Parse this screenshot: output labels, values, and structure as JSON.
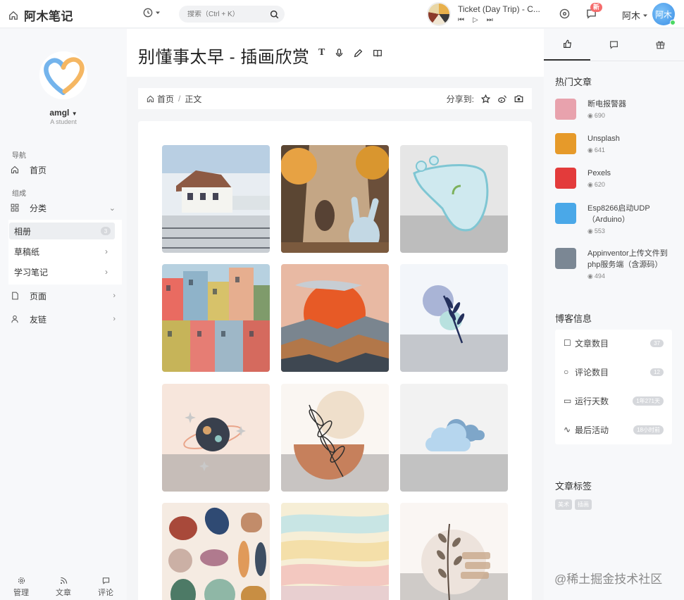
{
  "header": {
    "brand": "阿木笔记",
    "search_placeholder": "搜索（Ctrl + K）",
    "track_title": "Ticket (Day Trip) - C...",
    "notification_badge": "新",
    "user_name": "阿木",
    "avatar_text": "阿木"
  },
  "profile": {
    "name": "amgl",
    "subtitle": "A student"
  },
  "sidebar": {
    "nav_label": "导航",
    "home": "首页",
    "group_label": "组成",
    "category": "分类",
    "sub_items": [
      {
        "label": "相册",
        "count": "3"
      },
      {
        "label": "草稿纸"
      },
      {
        "label": "学习笔记"
      }
    ],
    "pages": "页面",
    "links": "友链",
    "bottom": [
      "管理",
      "文章",
      "评论"
    ]
  },
  "main": {
    "title": "别懂事太早 - 插画欣赏",
    "breadcrumb": {
      "home": "首页",
      "current": "正文"
    },
    "share_label": "分享到:"
  },
  "gallery": [
    {
      "icon": "train-station-illustration"
    },
    {
      "icon": "forest-rabbit-illustration"
    },
    {
      "icon": "foot-sprout-illustration"
    },
    {
      "icon": "colorful-city-illustration"
    },
    {
      "icon": "red-sun-mountains-illustration"
    },
    {
      "icon": "leaf-circle-illustration"
    },
    {
      "icon": "planet-stars-illustration"
    },
    {
      "icon": "boho-leaf-illustration"
    },
    {
      "icon": "cloud-illustration"
    },
    {
      "icon": "abstract-shapes-illustration"
    },
    {
      "icon": "pastel-landscape-illustration"
    },
    {
      "icon": "dried-plant-illustration"
    }
  ],
  "right": {
    "hot_label": "热门文章",
    "posts": [
      {
        "title": "断电报警器",
        "views": "690",
        "color": "#e8a2ad"
      },
      {
        "title": "Unsplash",
        "views": "641",
        "color": "#e69a2a"
      },
      {
        "title": "Pexels",
        "views": "620",
        "color": "#e33b3b"
      },
      {
        "title": "Esp8266启动UDP（Arduino）",
        "views": "553",
        "color": "#4aa8e8"
      },
      {
        "title": "Appinventor上传文件到php服务端（含源码）",
        "views": "494",
        "color": "#7b8794"
      }
    ],
    "blog_info_label": "博客信息",
    "info": [
      {
        "label": "文章数目",
        "value": "37"
      },
      {
        "label": "评论数目",
        "value": "12"
      },
      {
        "label": "运行天数",
        "value": "1年271天"
      },
      {
        "label": "最后活动",
        "value": "18小时前"
      }
    ],
    "tags_label": "文章标签",
    "tags": [
      "美术",
      "插画"
    ]
  },
  "watermark": "@稀土掘金技术社区"
}
